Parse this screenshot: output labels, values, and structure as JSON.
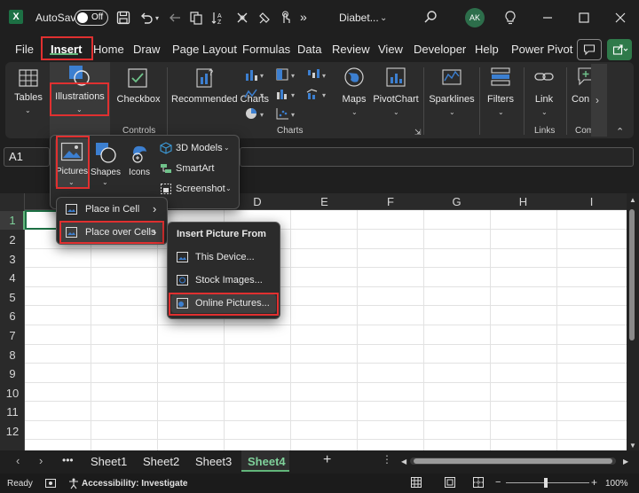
{
  "titlebar": {
    "app_icon": "X",
    "autosave_label": "AutoSave",
    "autosave_state": "Off",
    "document_name": "Diabet...",
    "user_initials": "AK"
  },
  "menu": {
    "tabs": [
      "File",
      "Insert",
      "Home",
      "Draw",
      "Page Layout",
      "Formulas",
      "Data",
      "Review",
      "View",
      "Developer",
      "Help",
      "Power Pivot"
    ],
    "active_tab": "Insert"
  },
  "ribbon": {
    "tables_label": "Tables",
    "illustrations_label": "Illustrations",
    "checkbox_label": "Checkbox",
    "recommended_charts_label": "Recommended Charts",
    "maps_label": "Maps",
    "pivotchart_label": "PivotChart",
    "sparklines_label": "Sparklines",
    "filters_label": "Filters",
    "link_label": "Link",
    "comment_label": "Con",
    "groups": {
      "controls": "Controls",
      "charts": "Charts",
      "links": "Links",
      "comments": "Com"
    }
  },
  "formula_bar": {
    "name_box": "A1"
  },
  "illustrations_dropdown": {
    "pictures_label": "Pictures",
    "shapes_label": "Shapes",
    "icons_label": "Icons",
    "models_label": "3D Models",
    "smartart_label": "SmartArt",
    "screenshot_label": "Screenshot"
  },
  "pictures_menu": {
    "items": [
      "Place in Cell",
      "Place over Cells"
    ]
  },
  "insert_picture_menu": {
    "header": "Insert Picture From",
    "items": [
      "This Device...",
      "Stock Images...",
      "Online Pictures..."
    ]
  },
  "grid": {
    "columns": [
      "D",
      "E",
      "F",
      "G",
      "H",
      "I"
    ],
    "rows": [
      "1",
      "2",
      "3",
      "4",
      "5",
      "6",
      "7",
      "8",
      "9",
      "10",
      "11",
      "12"
    ]
  },
  "sheets": {
    "tabs": [
      "Sheet1",
      "Sheet2",
      "Sheet3",
      "Sheet4"
    ],
    "active": "Sheet4"
  },
  "status": {
    "ready": "Ready",
    "accessibility": "Accessibility: Investigate",
    "zoom": "100%"
  },
  "colors": {
    "accent_green": "#62b57a",
    "highlight_red": "#e03030",
    "excel_green": "#1d7044"
  }
}
